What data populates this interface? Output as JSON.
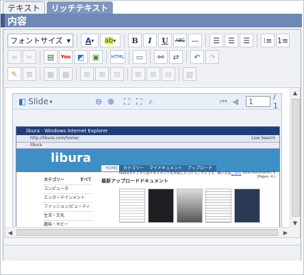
{
  "tabs": [
    "テキスト",
    "リッチテキスト"
  ],
  "header": {
    "title": "内容"
  },
  "toolbar": {
    "font_size_label": "フォントサイズ",
    "font_color_label": "A",
    "highlight_label": "ab",
    "bold": "B",
    "italic": "I",
    "underline": "U",
    "strike": "ABC",
    "html_label": "HTML"
  },
  "viewer": {
    "mode_label": "Slide",
    "page_value": "1",
    "page_total": "/ 1"
  },
  "browser": {
    "window_title": "libura - Windows Internet Explorer",
    "address": "http://libura.com/home/",
    "tab_label": "libura",
    "live_search": "Live Search",
    "site_logo": "libura",
    "nav": [
      "HOME",
      "カテゴリー",
      "マイドキュメント",
      "アップロード"
    ],
    "sidebar_heading": "カテゴリー",
    "sidebar_all": "すべて",
    "sidebar_items": [
      "コンピュータ",
      "エンターテインメント",
      "ファッション/ビューティ",
      "生活・文化",
      "趣味・ホビー"
    ],
    "intro_text": "liburaライブラリはドキュメントを共有したコミュニティです。使い方は",
    "intro_link": "こちら",
    "main_heading": "最新アップロードドキュメント",
    "stats": "Total Documents: 1",
    "pages": "(Pages: 4,)"
  },
  "colors": {
    "header": "#6e89b6",
    "header_bar": "#3f5b8c",
    "site_blue": "#3e8fc4"
  }
}
